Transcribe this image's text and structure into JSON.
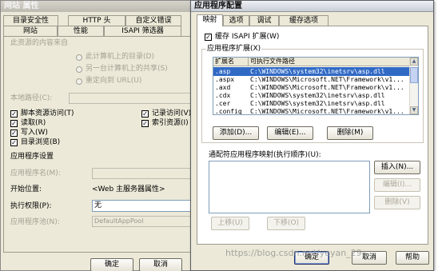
{
  "back_dialog": {
    "title": "网站 属性",
    "tabs_row1": [
      "目录安全性",
      "HTTP 头",
      "自定义错误"
    ],
    "tabs_row2": [
      "网站",
      "性能",
      "ISAPI 筛选器"
    ],
    "content_source_label": "此资源的内容来自",
    "radio_options": [
      "此计算机上的目录(D)",
      "另一台计算机上的共享(S)",
      "重定向到 URL(U)"
    ],
    "local_path_label": "本地路径(C):",
    "checkboxes_left": [
      {
        "label": "脚本资源访问(T)",
        "checked": true
      },
      {
        "label": "读取(R)",
        "checked": true
      },
      {
        "label": "写入(W)",
        "checked": true
      },
      {
        "label": "目录浏览(B)",
        "checked": true
      }
    ],
    "checkboxes_right": [
      {
        "label": "记录访问(V)",
        "checked": true
      },
      {
        "label": "索引资源(I)",
        "checked": true
      }
    ],
    "app_settings_label": "应用程序设置",
    "app_name_label": "应用程序名(M):",
    "start_point_label": "开始位置:",
    "start_point_value": "<Web 主服务器属性>",
    "exec_perm_label": "执行权限(P):",
    "exec_perm_value": "无",
    "app_pool_label": "应用程序池(N):",
    "app_pool_value": "DefaultAppPool",
    "ok_button": "确定",
    "cancel_button": "取消"
  },
  "front_dialog": {
    "title": "应用程序配置",
    "tabs": [
      "映射",
      "选项",
      "调试",
      "缓存选项"
    ],
    "cache_isapi_label": "缓存 ISAPI 扩展(W)",
    "cache_isapi_checked": true,
    "extensions_group_label": "应用程序扩展(X)",
    "list_headers": [
      "扩展名",
      "可执行文件路径"
    ],
    "list_rows": [
      {
        "ext": ".asp",
        "path": "C:\\WINDOWS\\system32\\inetsrv\\asp.dll",
        "selected": true
      },
      {
        "ext": ".aspx",
        "path": "C:\\WINDOWS\\Microsoft.NET\\Framework\\v1...",
        "selected": false
      },
      {
        "ext": ".axd",
        "path": "C:\\WINDOWS\\Microsoft.NET\\Framework\\v1...",
        "selected": false
      },
      {
        "ext": ".cdx",
        "path": "C:\\WINDOWS\\system32\\inetsrv\\asp.dll",
        "selected": false
      },
      {
        "ext": ".cer",
        "path": "C:\\WINDOWS\\system32\\inetsrv\\asp.dll",
        "selected": false
      },
      {
        "ext": ".config",
        "path": "C:\\WINDOWS\\Microsoft.NET\\Framework\\v1...",
        "selected": false
      }
    ],
    "add_button": "添加(D)...",
    "edit_button": "编辑(E)...",
    "delete_button": "删除(M)",
    "wildcard_label": "通配符应用程序映射(执行顺序)(U):",
    "insert_button": "插入(N)...",
    "wildcard_edit_button": "编辑(I)...",
    "wildcard_delete_button": "删除(V)",
    "move_up_button": "上移(U)",
    "move_down_button": "下移(O)",
    "ok_button": "确定",
    "cancel_button": "取消",
    "help_button": "帮助"
  },
  "watermark": "https://blog.csdn.net/yeyan_29..."
}
